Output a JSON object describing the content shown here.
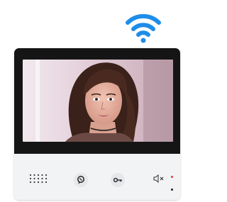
{
  "icons": {
    "wifi": "wifi-icon",
    "speaker": "speaker-grille-icon",
    "talk": "talk-icon",
    "unlock": "key-icon",
    "mute": "mute-icon"
  },
  "colors": {
    "wifi": "#1e8de8",
    "bezel": "#151515",
    "panel": "#f2f3f5",
    "led_red": "#e53935"
  }
}
